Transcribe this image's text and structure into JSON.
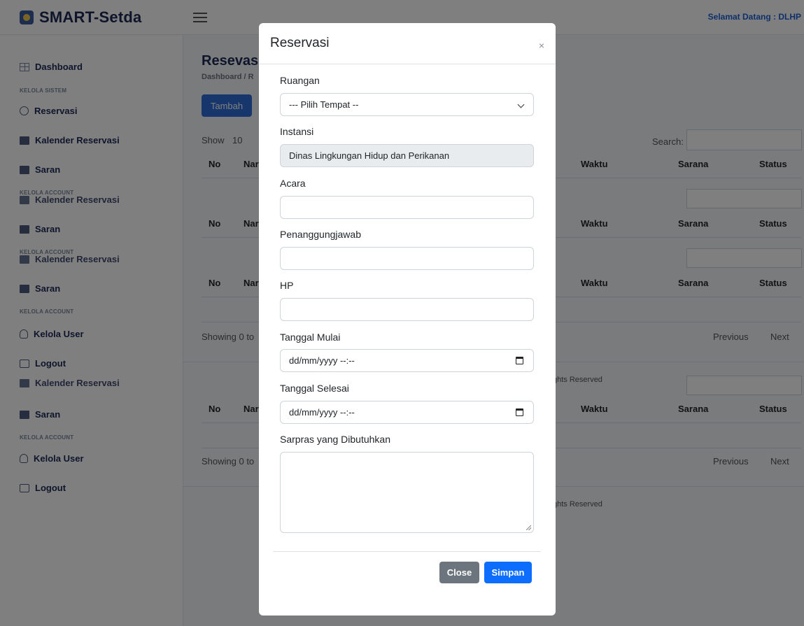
{
  "app": {
    "brand": "SMART-Setda",
    "welcome": "Selamat Datang : DLHP"
  },
  "sidebar": {
    "dashboard": "Dashboard",
    "sec_sistem": "KELOLA SISTEM",
    "reservasi": "Reservasi",
    "kalender": "Kalender Reservasi",
    "saran": "Saran",
    "sec_account": "KELOLA ACCOUNT",
    "kelola_user": "Kelola User",
    "logout": "Logout"
  },
  "main": {
    "title": "Resevasi",
    "breadcrumb": "Dashboard / R",
    "add_button": "Tambah",
    "show_label": "Show",
    "show_value": "10",
    "search_label": "Search:",
    "col_no": "No",
    "col_nama": "Nar",
    "col_waktu": "Waktu",
    "col_sarana": "Sarana",
    "col_status": "Status",
    "showing": "Showing 0 to",
    "previous": "Previous",
    "next": "Next",
    "rights": "ghts Reserved"
  },
  "modal": {
    "title": "Reservasi",
    "close_x": "×",
    "ruangan_label": "Ruangan",
    "ruangan_value": "--- Pilih Tempat --",
    "instansi_label": "Instansi",
    "instansi_value": "Dinas Lingkungan Hidup dan Perikanan",
    "acara_label": "Acara",
    "pj_label": "Penanggungjawab",
    "hp_label": "HP",
    "mulai_label": "Tanggal Mulai",
    "mulai_value": "dd/mm/yyyy --:--",
    "selesai_label": "Tanggal Selesai",
    "selesai_value": "dd/mm/yyyy --:--",
    "sarpras_label": "Sarpras yang Dibutuhkan",
    "close_button": "Close",
    "save_button": "Simpan"
  },
  "colors": {
    "primary": "#0d6efd",
    "secondary": "#6c757d",
    "brand": "#1d2a57"
  }
}
